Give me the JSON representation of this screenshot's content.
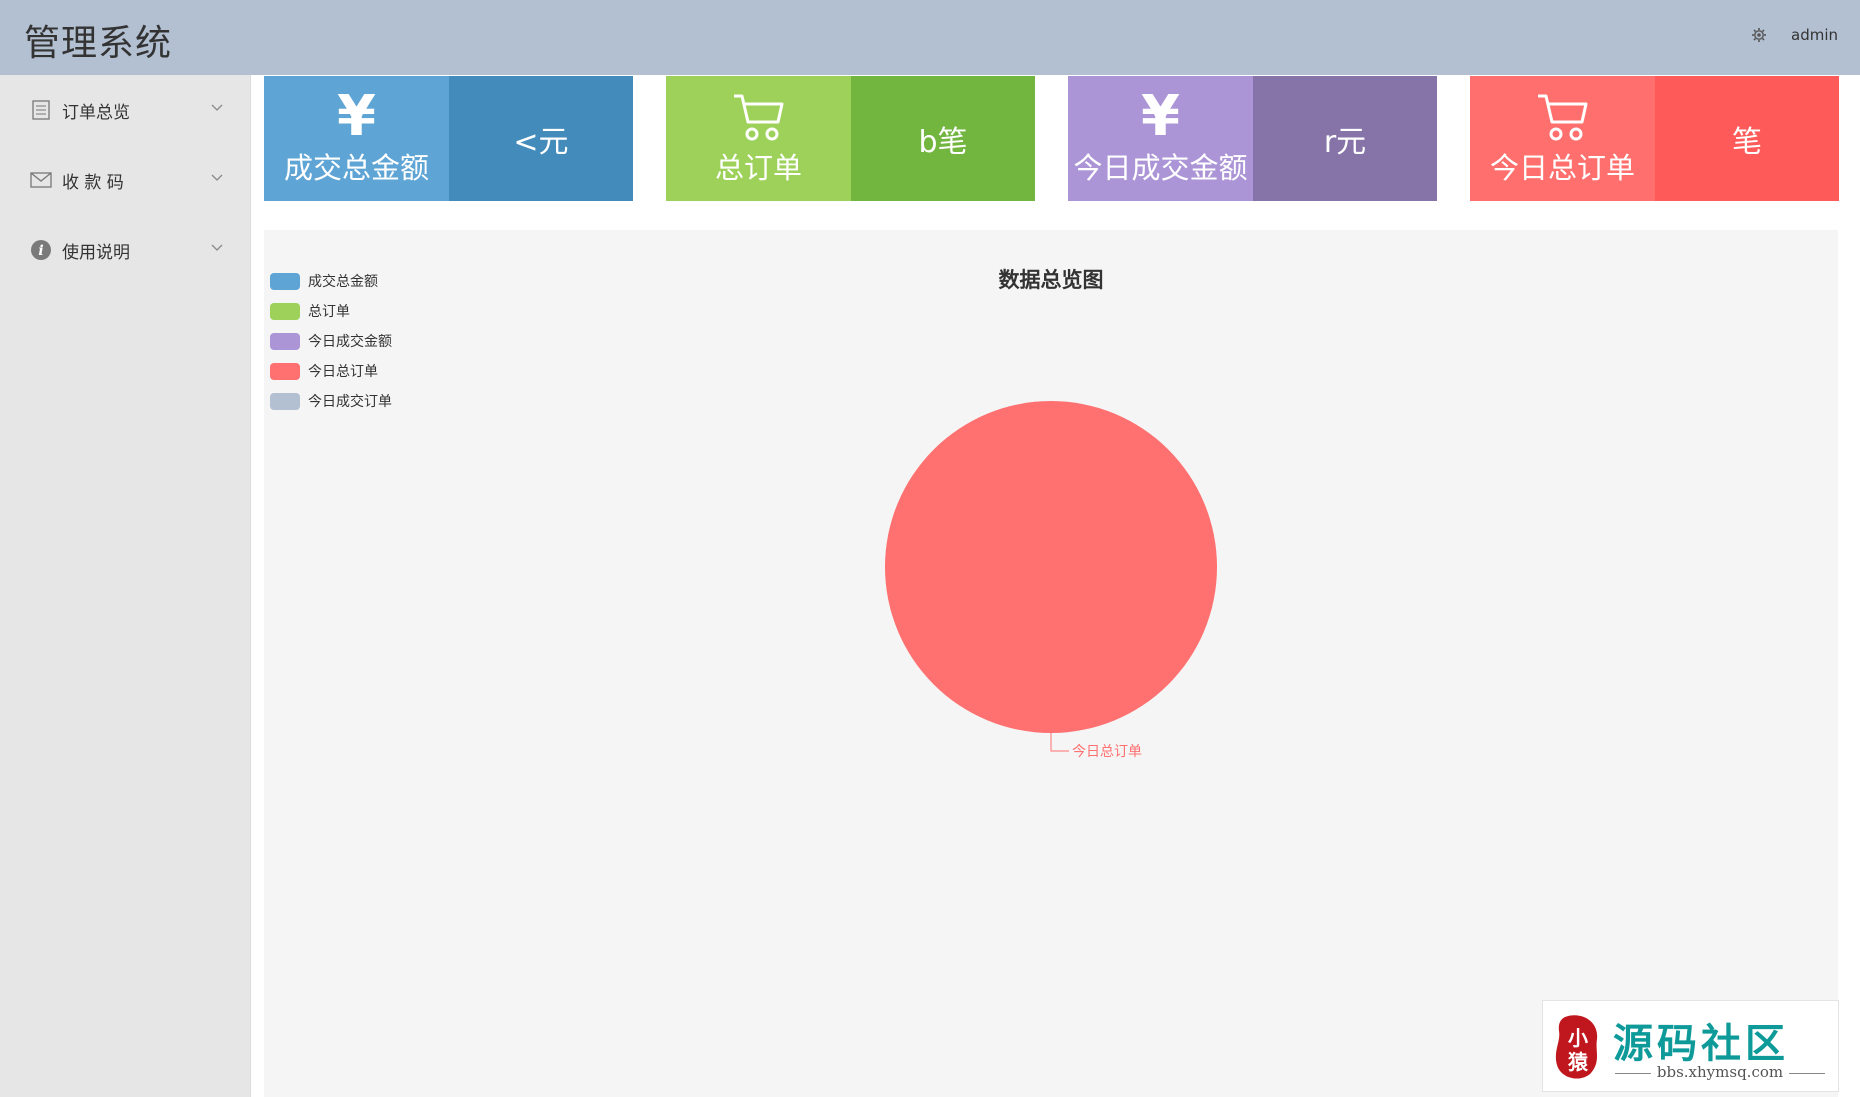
{
  "header": {
    "logo": "管理系统",
    "settings_icon": "gear-icon",
    "username": "admin"
  },
  "sidebar": {
    "items": [
      {
        "label": "订单总览",
        "icon": "document-icon"
      },
      {
        "label": "收 款 码",
        "icon": "envelope-icon"
      },
      {
        "label": "使用说明",
        "icon": "info-icon"
      }
    ]
  },
  "cards": [
    {
      "icon": "yen-icon",
      "title": "成交总金额",
      "value": "<元",
      "color_left": "#5ea4d4",
      "color_right": "#428bbb"
    },
    {
      "icon": "cart-icon",
      "title": "总订单",
      "value": "b笔",
      "color_left": "#9dd15a",
      "color_right": "#72b53f"
    },
    {
      "icon": "yen-icon",
      "title": "今日成交金额",
      "value": "r元",
      "color_left": "#ac95d6",
      "color_right": "#8673a8"
    },
    {
      "icon": "cart-icon",
      "title": "今日总订单",
      "value": "笔",
      "color_left": "#ff6f6d",
      "color_right": "#ff5a5a"
    }
  ],
  "chart_data": {
    "type": "pie",
    "title": "数据总览图",
    "legend_position": "top-left",
    "series": [
      {
        "name": "成交总金额",
        "value": 0,
        "color": "#5ea4d4"
      },
      {
        "name": "总订单",
        "value": 0,
        "color": "#9dd15a"
      },
      {
        "name": "今日成交金额",
        "value": 0,
        "color": "#ac95d6"
      },
      {
        "name": "今日总订单",
        "value": 1,
        "color": "#ff7070"
      },
      {
        "name": "今日成交订单",
        "value": 0,
        "color": "#b3c0d2"
      }
    ],
    "slice_label": "今日总订单"
  },
  "watermark": {
    "seal_text": "小猿",
    "main": "源码社区",
    "sub": "bbs.xhymsq.com"
  }
}
